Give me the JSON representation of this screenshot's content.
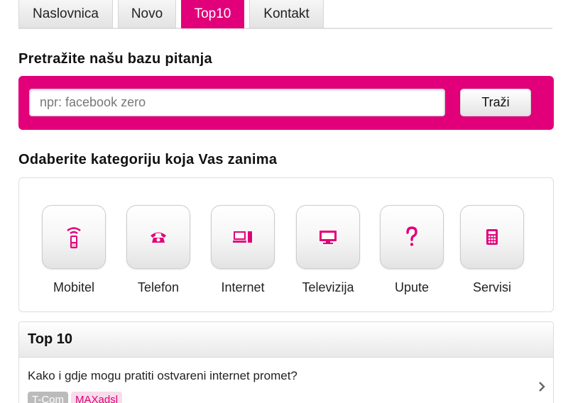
{
  "nav": {
    "tabs": [
      {
        "label": "Naslovnica",
        "active": false
      },
      {
        "label": "Novo",
        "active": false
      },
      {
        "label": "Top10",
        "active": true
      },
      {
        "label": "Kontakt",
        "active": false
      }
    ]
  },
  "search": {
    "heading": "Pretražite našu bazu pitanja",
    "placeholder": "npr: facebook zero",
    "value": "",
    "button_label": "Traži"
  },
  "categories": {
    "heading": "Odaberite kategoriju koja Vas zanima",
    "items": [
      {
        "label": "Mobitel",
        "icon": "mobile-phone-icon"
      },
      {
        "label": "Telefon",
        "icon": "telephone-icon"
      },
      {
        "label": "Internet",
        "icon": "computer-icon"
      },
      {
        "label": "Televizija",
        "icon": "tv-icon"
      },
      {
        "label": "Upute",
        "icon": "question-mark-icon"
      },
      {
        "label": "Servisi",
        "icon": "calculator-icon"
      }
    ]
  },
  "top10": {
    "title": "Top 10",
    "items": [
      {
        "question": "Kako i gdje mogu pratiti ostvareni internet promet?",
        "tags": [
          "T-Com",
          "MAXadsl"
        ]
      }
    ]
  },
  "colors": {
    "accent": "#e2007a",
    "tab_bg": "#eeeeee",
    "tag_grey": "#bbbbbb",
    "tag_pink_bg": "#f7dcea"
  }
}
